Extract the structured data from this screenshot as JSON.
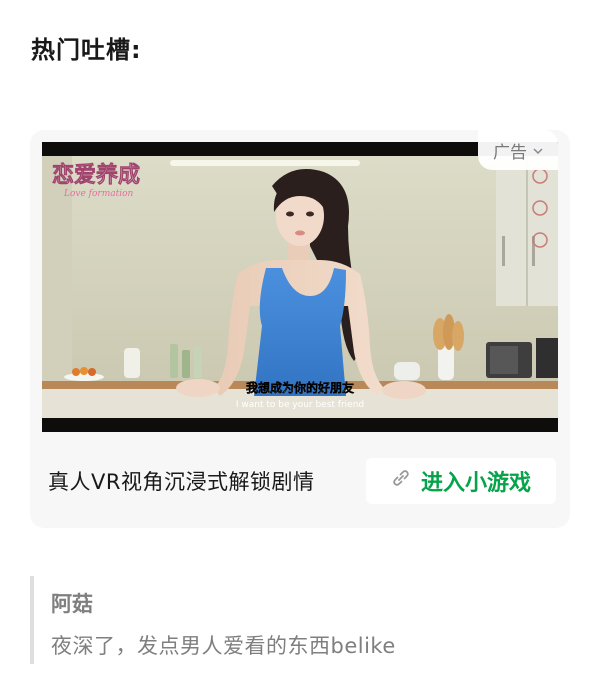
{
  "section_title": "热门吐槽:",
  "ad": {
    "badge_label": "广告",
    "game_logo_text": "恋爱养成",
    "game_logo_subtext": "Love formation",
    "subtitle_cn": "我想成为你的好朋友",
    "subtitle_en": "I want to be your best friend",
    "description": "真人VR视角沉浸式解锁剧情",
    "cta_label": "进入小游戏",
    "colors": {
      "card_bg": "#f7f7f7",
      "cta_text": "#07a34a",
      "top_dress": "#3e86d6"
    },
    "icons": {
      "badge_chevron": "chevron-down-icon",
      "cta_icon": "link-icon"
    }
  },
  "quote": {
    "author": "阿菇",
    "text": "夜深了，发点男人爱看的东西belike"
  }
}
